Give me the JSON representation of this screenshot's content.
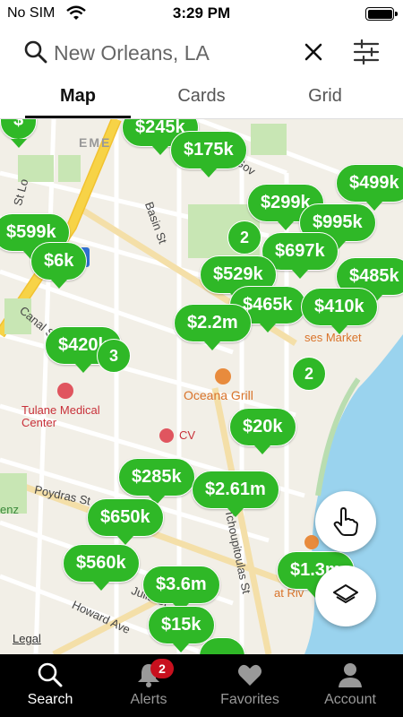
{
  "status_bar": {
    "carrier": "No SIM",
    "time": "3:29 PM"
  },
  "search": {
    "value": "New Orleans, LA",
    "placeholder": ""
  },
  "tabs": [
    {
      "label": "Map",
      "active": true
    },
    {
      "label": "Cards",
      "active": false
    },
    {
      "label": "Grid",
      "active": false
    }
  ],
  "map": {
    "price_pins": [
      "$245k",
      "$175k",
      "$499k",
      "$299k",
      "$995k",
      "$599k",
      "$6k",
      "$697k",
      "$529k",
      "$485k",
      "$465k",
      "$410k",
      "$2.2m",
      "$420k",
      "$20k",
      "$285k",
      "$2.61m",
      "$650k",
      "$560k",
      "$1.3m",
      "$3.6m",
      "$15k"
    ],
    "clusters": [
      "2",
      "2",
      "3"
    ],
    "street_labels": [
      "Basin St",
      "Canal St",
      "Poydras St",
      "Tchoupitoulas St",
      "Howard Ave",
      "Julia St",
      "Gov",
      "St Lo"
    ],
    "poi_labels": [
      "Tulane Medical Center",
      "Oceana Grill",
      "Legal",
      "EME",
      "ses Market",
      "at Riv",
      "enz",
      "CV"
    ],
    "colors": {
      "pin": "#2fb827",
      "water": "#9ad3ee",
      "park": "#c8e6b4",
      "highway": "#f7d347"
    }
  },
  "fabs": [
    {
      "icon": "hand-pointer-icon"
    },
    {
      "icon": "layers-icon"
    }
  ],
  "bottom_nav": [
    {
      "label": "Search",
      "icon": "search-icon",
      "active": true
    },
    {
      "label": "Alerts",
      "icon": "bell-icon",
      "active": false,
      "badge": "2"
    },
    {
      "label": "Favorites",
      "icon": "heart-icon",
      "active": false
    },
    {
      "label": "Account",
      "icon": "person-icon",
      "active": false
    }
  ]
}
